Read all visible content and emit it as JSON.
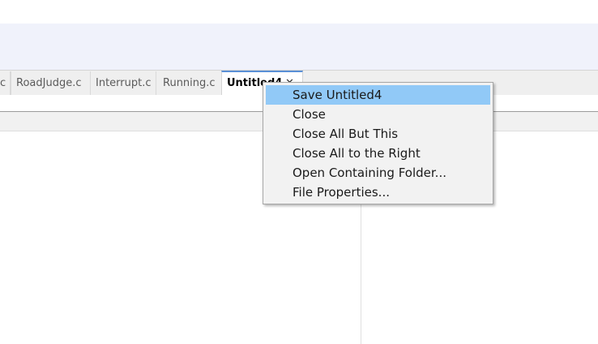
{
  "tabs": {
    "partial_label": "c",
    "items": [
      {
        "label": "RoadJudge.c"
      },
      {
        "label": "Interrupt.c"
      },
      {
        "label": "Running.c"
      }
    ],
    "active": {
      "label": "Untitled4",
      "close_icon": "✕"
    }
  },
  "context_menu": {
    "items": [
      {
        "label": "Save Untitled4",
        "selected": true
      },
      {
        "label": "Close"
      },
      {
        "label": "Close All But This"
      },
      {
        "label": "Close All to the Right"
      },
      {
        "label": "Open Containing Folder..."
      },
      {
        "label": "File Properties..."
      }
    ],
    "highlight_color": "#91c9f7"
  },
  "colors": {
    "toolbar_band": "#f0f2fb",
    "tabbar": "#efefef",
    "active_tab_accent": "#5a8fd6"
  }
}
